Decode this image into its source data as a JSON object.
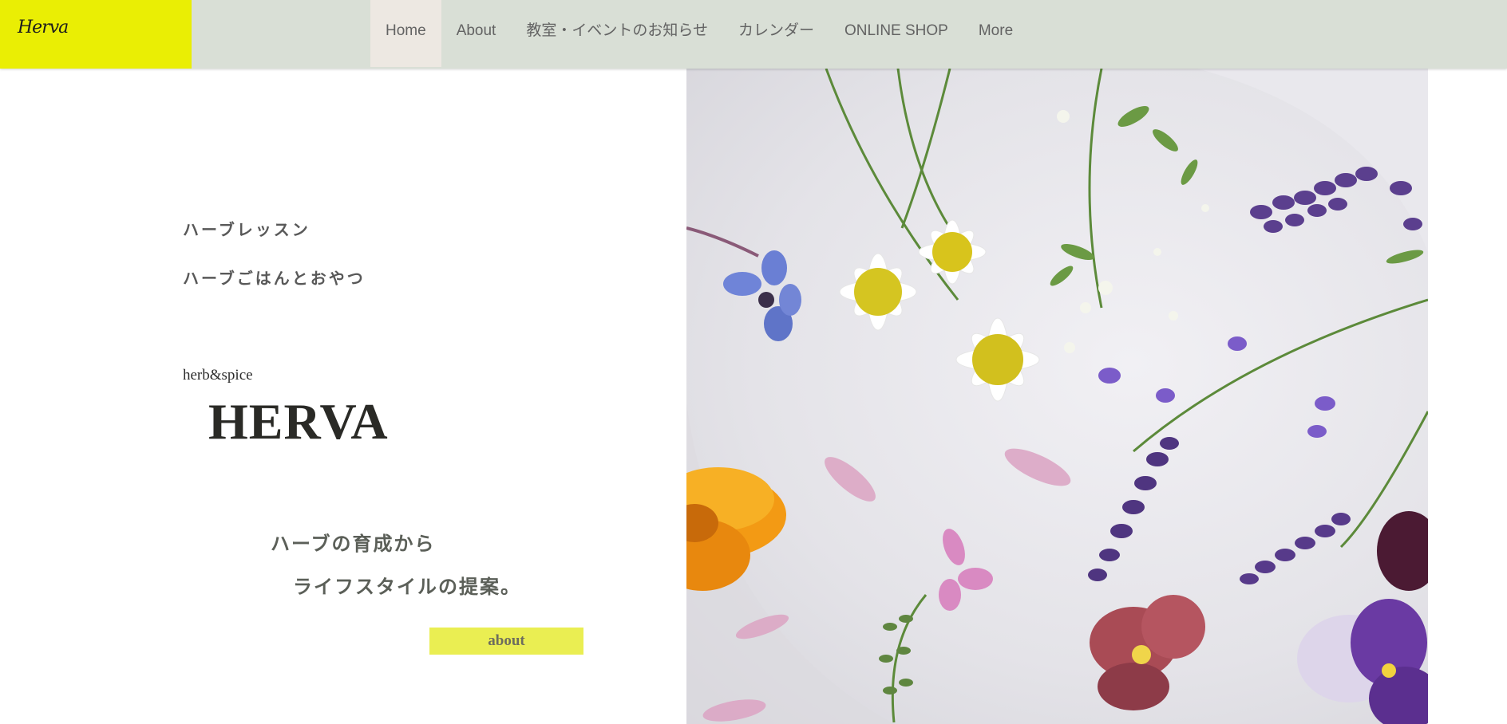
{
  "header": {
    "logo": "Herva",
    "nav": [
      {
        "label": "Home",
        "active": true
      },
      {
        "label": "About",
        "active": false
      },
      {
        "label": "教室・イベントのお知らせ",
        "active": false
      },
      {
        "label": "カレンダー",
        "active": false
      },
      {
        "label": "ONLINE SHOP",
        "active": false
      },
      {
        "label": "More",
        "active": false
      }
    ]
  },
  "hero": {
    "line1": "ハーブレッスン",
    "line2": "ハーブごはんとおやつ",
    "sub_brand": "herb&spice",
    "title": "HERVA",
    "tagline1": "ハーブの育成から",
    "tagline2": "ライフスタイルの提案。",
    "button_label": "about"
  },
  "colors": {
    "header_bg": "#d9dfd6",
    "logo_bg": "#eaee04",
    "button_bg": "#eaee52",
    "active_tab_bg": "#ede8e2"
  },
  "photo": {
    "subject": "edible flowers and herbs on a white plate"
  }
}
